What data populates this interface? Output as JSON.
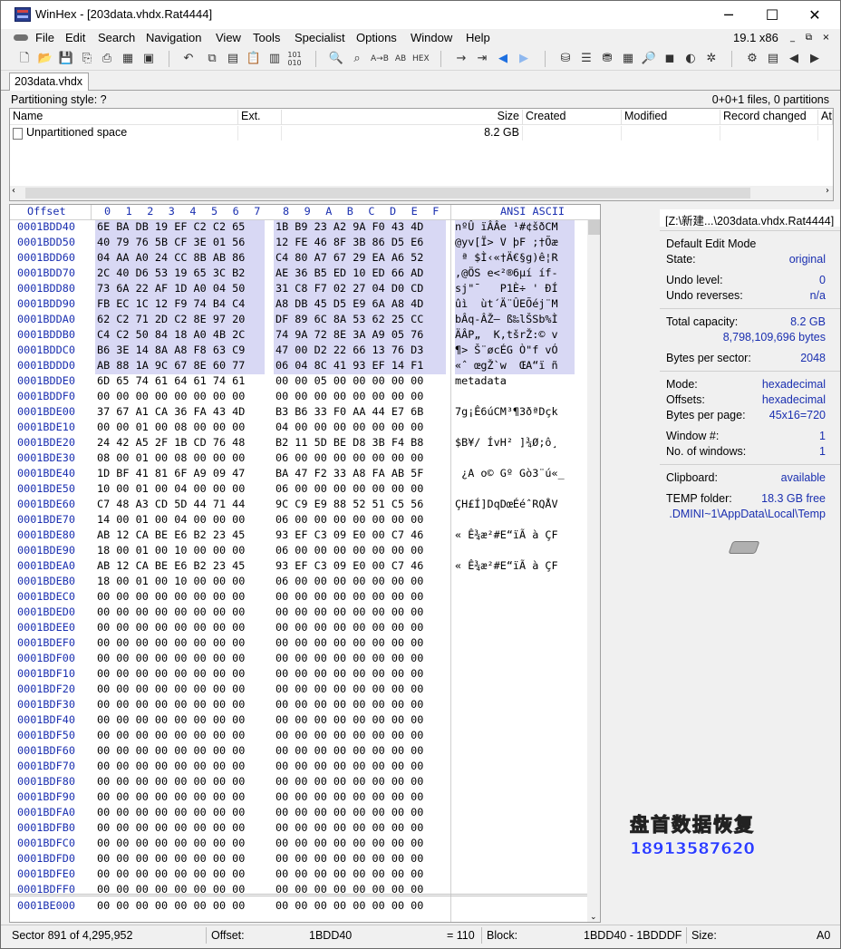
{
  "window": {
    "title": "WinHex - [203data.vhdx.Rat4444]",
    "app_icon": "winhex-app-icon",
    "buttons": {
      "min": "─",
      "max": "☐",
      "close": "✕"
    }
  },
  "menu": {
    "items": [
      "File",
      "Edit",
      "Search",
      "Navigation",
      "View",
      "Tools",
      "Specialist",
      "Options",
      "Window",
      "Help"
    ],
    "version": "19.1 x86",
    "mdi": {
      "min": "_",
      "restore": "⧉",
      "close": "×"
    }
  },
  "toolbar": {
    "icons": [
      "new-file-icon",
      "open-file-icon",
      "save-icon",
      "save-all-icon",
      "print-icon",
      "properties-icon",
      "open-folder-icon",
      "undo-icon",
      "copy-icon",
      "paste-icon",
      "clipboard-icon",
      "paste-write-icon",
      "binary-icon",
      "find-text-icon",
      "find-hex-icon",
      "replace-text-icon",
      "replace-hex-icon",
      "goto-offset-icon",
      "goto-sector-icon",
      "back-icon",
      "forward-icon",
      "open-disk-icon",
      "open-raid-icon",
      "clone-disk-icon",
      "ram-icon",
      "lens-icon",
      "analyze-icon",
      "explorer-icon",
      "settings-icon",
      "calc-icon",
      "table-icon",
      "prev-icon",
      "next-icon"
    ]
  },
  "tab": {
    "label": "203data.vhdx"
  },
  "partition": {
    "style": "Partitioning style: ?",
    "count": "0+0+1 files, 0 partitions"
  },
  "dirlist": {
    "columns": [
      "Name",
      "Ext.",
      "Size",
      "Created",
      "Modified",
      "Record changed",
      "Att"
    ],
    "rows": [
      {
        "name": "Unpartitioned space",
        "ext": "",
        "size": "8.2 GB",
        "created": "",
        "modified": "",
        "record_changed": "",
        "attr": ""
      }
    ]
  },
  "hex": {
    "header": {
      "offset": "Offset",
      "cols": [
        "0",
        "1",
        "2",
        "3",
        "4",
        "5",
        "6",
        "7",
        "8",
        "9",
        "A",
        "B",
        "C",
        "D",
        "E",
        "F"
      ],
      "ascii": "ANSI ASCII"
    },
    "rows": [
      {
        "off": "0001BDD40",
        "h1": "6E BA DB 19 EF C2 C2 65",
        "h2": "1B B9 23 A2 9A F0 43 4D",
        "a": "nºÛ ïÂÂe ¹#¢šðCM",
        "sel": true
      },
      {
        "off": "0001BDD50",
        "h1": "40 79 76 5B CF 3E 01 56",
        "h2": "12 FE 46 8F 3B 86 D5 E6",
        "a": "@yv[Ï> V þF ;†Õæ",
        "sel": true
      },
      {
        "off": "0001BDD60",
        "h1": "04 AA A0 24 CC 8B AB 86",
        "h2": "C4 80 A7 67 29 EA A6 52",
        "a": " ª $Ì‹«†Ä€§g)ê¦R",
        "sel": true
      },
      {
        "off": "0001BDD70",
        "h1": "2C 40 D6 53 19 65 3C B2",
        "h2": "AE 36 B5 ED 10 ED 66 AD",
        "a": ",@ÖS e<²®6µí íf-",
        "sel": true
      },
      {
        "off": "0001BDD80",
        "h1": "73 6A 22 AF 1D A0 04 50",
        "h2": "31 C8 F7 02 27 04 D0 CD",
        "a": "sj\"¯   P1È÷ ' ÐÍ",
        "sel": true
      },
      {
        "off": "0001BDD90",
        "h1": "FB EC 1C 12 F9 74 B4 C4",
        "h2": "A8 DB 45 D5 E9 6A A8 4D",
        "a": "ûì  ùt´Ä¨ÛEÕéj¨M",
        "sel": true
      },
      {
        "off": "0001BDDA0",
        "h1": "62 C2 71 2D C2 8E 97 20",
        "h2": "DF 89 6C 8A 53 62 25 CC",
        "a": "bÂq-ÂŽ— ß‰lŠSb%Ì",
        "sel": true
      },
      {
        "off": "0001BDDB0",
        "h1": "C4 C2 50 84 18 A0 4B 2C",
        "h2": "74 9A 72 8E 3A A9 05 76",
        "a": "ÄÂP„  K,tšrŽ:© v",
        "sel": true
      },
      {
        "off": "0001BDDC0",
        "h1": "B6 3E 14 8A A8 F8 63 C9",
        "h2": "47 00 D2 22 66 13 76 D3",
        "a": "¶> Š¨øcÉG Ò\"f vÓ",
        "sel": true
      },
      {
        "off": "0001BDDD0",
        "h1": "AB 88 1A 9C 67 8E 60 77",
        "h2": "06 04 8C 41 93 EF 14 F1",
        "a": "«ˆ œgŽ`w  ŒA“ï ñ",
        "sel": true
      },
      {
        "off": "0001BDDE0",
        "h1": "6D 65 74 61 64 61 74 61",
        "h2": "00 00 05 00 00 00 00 00",
        "a": "metadata",
        "sel": false
      },
      {
        "off": "0001BDDF0",
        "h1": "00 00 00 00 00 00 00 00",
        "h2": "00 00 00 00 00 00 00 00",
        "a": "",
        "sel": false
      },
      {
        "off": "0001BDE00",
        "h1": "37 67 A1 CA 36 FA 43 4D",
        "h2": "B3 B6 33 F0 AA 44 E7 6B",
        "a": "7g¡Ê6úCM³¶3ðªDçk",
        "sel": false
      },
      {
        "off": "0001BDE10",
        "h1": "00 00 01 00 08 00 00 00",
        "h2": "04 00 00 00 00 00 00 00",
        "a": "",
        "sel": false
      },
      {
        "off": "0001BDE20",
        "h1": "24 42 A5 2F 1B CD 76 48",
        "h2": "B2 11 5D BE D8 3B F4 B8",
        "a": "$B¥/ ÍvH² ]¾Ø;ô¸",
        "sel": false
      },
      {
        "off": "0001BDE30",
        "h1": "08 00 01 00 08 00 00 00",
        "h2": "06 00 00 00 00 00 00 00",
        "a": "",
        "sel": false
      },
      {
        "off": "0001BDE40",
        "h1": "1D BF 41 81 6F A9 09 47",
        "h2": "BA 47 F2 33 A8 FA AB 5F",
        "a": " ¿A o© Gº Gò3¨ú«_",
        "sel": false
      },
      {
        "off": "0001BDE50",
        "h1": "10 00 01 00 04 00 00 00",
        "h2": "06 00 00 00 00 00 00 00",
        "a": "",
        "sel": false
      },
      {
        "off": "0001BDE60",
        "h1": "C7 48 A3 CD 5D 44 71 44",
        "h2": "9C C9 E9 88 52 51 C5 56",
        "a": "ÇH£Í]DqDœÉéˆRQÅV",
        "sel": false
      },
      {
        "off": "0001BDE70",
        "h1": "14 00 01 00 04 00 00 00",
        "h2": "06 00 00 00 00 00 00 00",
        "a": "",
        "sel": false
      },
      {
        "off": "0001BDE80",
        "h1": "AB 12 CA BE E6 B2 23 45",
        "h2": "93 EF C3 09 E0 00 C7 46",
        "a": "« Ê¾æ²#E“ïÃ à ÇF",
        "sel": false
      },
      {
        "off": "0001BDE90",
        "h1": "18 00 01 00 10 00 00 00",
        "h2": "06 00 00 00 00 00 00 00",
        "a": "",
        "sel": false
      },
      {
        "off": "0001BDEA0",
        "h1": "AB 12 CA BE E6 B2 23 45",
        "h2": "93 EF C3 09 E0 00 C7 46",
        "a": "« Ê¾æ²#E“ïÃ à ÇF",
        "sel": false
      },
      {
        "off": "0001BDEB0",
        "h1": "18 00 01 00 10 00 00 00",
        "h2": "06 00 00 00 00 00 00 00",
        "a": "",
        "sel": false
      },
      {
        "off": "0001BDEC0",
        "h1": "00 00 00 00 00 00 00 00",
        "h2": "00 00 00 00 00 00 00 00",
        "a": "",
        "sel": false
      },
      {
        "off": "0001BDED0",
        "h1": "00 00 00 00 00 00 00 00",
        "h2": "00 00 00 00 00 00 00 00",
        "a": "",
        "sel": false
      },
      {
        "off": "0001BDEE0",
        "h1": "00 00 00 00 00 00 00 00",
        "h2": "00 00 00 00 00 00 00 00",
        "a": "",
        "sel": false
      },
      {
        "off": "0001BDEF0",
        "h1": "00 00 00 00 00 00 00 00",
        "h2": "00 00 00 00 00 00 00 00",
        "a": "",
        "sel": false
      },
      {
        "off": "0001BDF00",
        "h1": "00 00 00 00 00 00 00 00",
        "h2": "00 00 00 00 00 00 00 00",
        "a": "",
        "sel": false
      },
      {
        "off": "0001BDF10",
        "h1": "00 00 00 00 00 00 00 00",
        "h2": "00 00 00 00 00 00 00 00",
        "a": "",
        "sel": false
      },
      {
        "off": "0001BDF20",
        "h1": "00 00 00 00 00 00 00 00",
        "h2": "00 00 00 00 00 00 00 00",
        "a": "",
        "sel": false
      },
      {
        "off": "0001BDF30",
        "h1": "00 00 00 00 00 00 00 00",
        "h2": "00 00 00 00 00 00 00 00",
        "a": "",
        "sel": false
      },
      {
        "off": "0001BDF40",
        "h1": "00 00 00 00 00 00 00 00",
        "h2": "00 00 00 00 00 00 00 00",
        "a": "",
        "sel": false
      },
      {
        "off": "0001BDF50",
        "h1": "00 00 00 00 00 00 00 00",
        "h2": "00 00 00 00 00 00 00 00",
        "a": "",
        "sel": false
      },
      {
        "off": "0001BDF60",
        "h1": "00 00 00 00 00 00 00 00",
        "h2": "00 00 00 00 00 00 00 00",
        "a": "",
        "sel": false
      },
      {
        "off": "0001BDF70",
        "h1": "00 00 00 00 00 00 00 00",
        "h2": "00 00 00 00 00 00 00 00",
        "a": "",
        "sel": false
      },
      {
        "off": "0001BDF80",
        "h1": "00 00 00 00 00 00 00 00",
        "h2": "00 00 00 00 00 00 00 00",
        "a": "",
        "sel": false
      },
      {
        "off": "0001BDF90",
        "h1": "00 00 00 00 00 00 00 00",
        "h2": "00 00 00 00 00 00 00 00",
        "a": "",
        "sel": false
      },
      {
        "off": "0001BDFA0",
        "h1": "00 00 00 00 00 00 00 00",
        "h2": "00 00 00 00 00 00 00 00",
        "a": "",
        "sel": false
      },
      {
        "off": "0001BDFB0",
        "h1": "00 00 00 00 00 00 00 00",
        "h2": "00 00 00 00 00 00 00 00",
        "a": "",
        "sel": false
      },
      {
        "off": "0001BDFC0",
        "h1": "00 00 00 00 00 00 00 00",
        "h2": "00 00 00 00 00 00 00 00",
        "a": "",
        "sel": false
      },
      {
        "off": "0001BDFD0",
        "h1": "00 00 00 00 00 00 00 00",
        "h2": "00 00 00 00 00 00 00 00",
        "a": "",
        "sel": false
      },
      {
        "off": "0001BDFE0",
        "h1": "00 00 00 00 00 00 00 00",
        "h2": "00 00 00 00 00 00 00 00",
        "a": "",
        "sel": false
      },
      {
        "off": "0001BDFF0",
        "h1": "00 00 00 00 00 00 00 00",
        "h2": "00 00 00 00 00 00 00 00",
        "a": "",
        "sel": false
      }
    ],
    "bottom_row": {
      "off": "0001BE000",
      "h1": "00 00 00 00 00 00 00 00",
      "h2": "00 00 00 00 00 00 00 00",
      "a": ""
    }
  },
  "info": {
    "path": "[Z:\\新建...\\203data.vhdx.Rat4444]",
    "edit_mode": "Default Edit Mode",
    "state_label": "State:",
    "state": "original",
    "undo_level_label": "Undo level:",
    "undo_level": "0",
    "undo_rev_label": "Undo reverses:",
    "undo_rev": "n/a",
    "capacity_label": "Total capacity:",
    "capacity": "8.2 GB",
    "capacity_bytes": "8,798,109,696 bytes",
    "bps_label": "Bytes per sector:",
    "bps": "2048",
    "mode_label": "Mode:",
    "mode": "hexadecimal",
    "offsets_label": "Offsets:",
    "offsets": "hexadecimal",
    "bpp_label": "Bytes per page:",
    "bpp": "45x16=720",
    "window_no_label": "Window #:",
    "window_no": "1",
    "num_windows_label": "No. of windows:",
    "num_windows": "1",
    "clipboard_label": "Clipboard:",
    "clipboard": "available",
    "temp_label": "TEMP folder:",
    "temp": "18.3 GB free",
    "temp_path": ".DMINI~1\\AppData\\Local\\Temp",
    "drive_icon": "drive-icon"
  },
  "watermark": {
    "company": "盘首数据恢复",
    "phone": "18913587620"
  },
  "status": {
    "sector": "Sector 891 of 4,295,952",
    "offset_label": "Offset:",
    "offset": "1BDD40",
    "value": "= 110",
    "block_label": "Block:",
    "block": "1BDD40 - 1BDDDF",
    "size_label": "Size:",
    "size": "A0"
  }
}
